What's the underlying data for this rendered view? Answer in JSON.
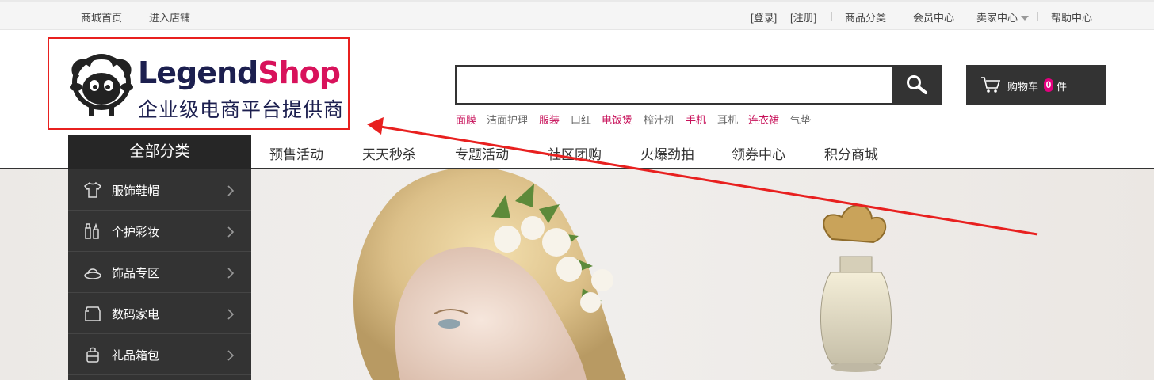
{
  "topbar": {
    "home": "商城首页",
    "enter_store": "进入店铺",
    "login": "[登录]",
    "register": "[注册]",
    "categories": "商品分类",
    "member_center": "会员中心",
    "seller_center": "卖家中心",
    "help_center": "帮助中心"
  },
  "logo": {
    "brand_a": "Legend",
    "brand_b": "Shop",
    "tagline": "企业级电商平台提供商"
  },
  "search": {
    "placeholder": "",
    "value": ""
  },
  "hotwords": [
    "面膜",
    "洁面护理",
    "服装",
    "口红",
    "电饭煲",
    "榨汁机",
    "手机",
    "耳机",
    "连衣裙",
    "气垫"
  ],
  "cart": {
    "label": "购物车",
    "count": "0",
    "unit": "件"
  },
  "nav": {
    "all_categories": "全部分类",
    "links": [
      "预售活动",
      "天天秒杀",
      "专题活动",
      "社区团购",
      "火爆劲拍",
      "领券中心",
      "积分商城"
    ]
  },
  "sidebar": {
    "items": [
      {
        "label": "服饰鞋帽",
        "icon": "shirt-icon"
      },
      {
        "label": "个护彩妆",
        "icon": "cosmetics-icon"
      },
      {
        "label": "饰品专区",
        "icon": "hat-icon"
      },
      {
        "label": "数码家电",
        "icon": "appliance-icon"
      },
      {
        "label": "礼品箱包",
        "icon": "bag-icon"
      }
    ]
  },
  "colors": {
    "accent": "#e4007f",
    "dark": "#333333",
    "annotation": "#e8201f"
  }
}
